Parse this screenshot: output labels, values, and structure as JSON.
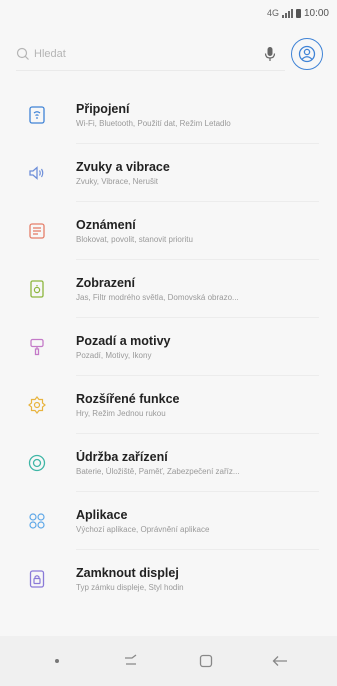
{
  "status": {
    "time": "10:00",
    "network": "4G"
  },
  "search": {
    "placeholder": "Hledat"
  },
  "colors": {
    "accent": "#3f83d6"
  },
  "settings": [
    {
      "title": "Připojení",
      "subtitle": "Wi-Fi, Bluetooth, Použití dat, Režim Letadlo",
      "icon": "connections-icon",
      "color": "#3f83d6"
    },
    {
      "title": "Zvuky a vibrace",
      "subtitle": "Zvuky, Vibrace, Nerušit",
      "icon": "sound-icon",
      "color": "#6e8fd9"
    },
    {
      "title": "Oznámení",
      "subtitle": "Blokovat, povolit, stanovit prioritu",
      "icon": "notifications-icon",
      "color": "#e57e68"
    },
    {
      "title": "Zobrazení",
      "subtitle": "Jas, Filtr modrého světla, Domovská obrazo...",
      "icon": "display-icon",
      "color": "#8cb63c"
    },
    {
      "title": "Pozadí a motivy",
      "subtitle": "Pozadí, Motivy, Ikony",
      "icon": "wallpaper-icon",
      "color": "#c47ac8"
    },
    {
      "title": "Rozšířené funkce",
      "subtitle": "Hry, Režim Jednou rukou",
      "icon": "advanced-features-icon",
      "color": "#e8b43f"
    },
    {
      "title": "Údržba zařízení",
      "subtitle": "Baterie, Úložiště, Paměť, Zabezpečení zaříz...",
      "icon": "device-maintenance-icon",
      "color": "#3fb6a6"
    },
    {
      "title": "Aplikace",
      "subtitle": "Výchozí aplikace, Oprávnění aplikace",
      "icon": "apps-icon",
      "color": "#5fa8e8"
    },
    {
      "title": "Zamknout displej",
      "subtitle": "Typ zámku displeje, Styl hodin",
      "icon": "lock-screen-icon",
      "color": "#8a7ad8"
    }
  ]
}
